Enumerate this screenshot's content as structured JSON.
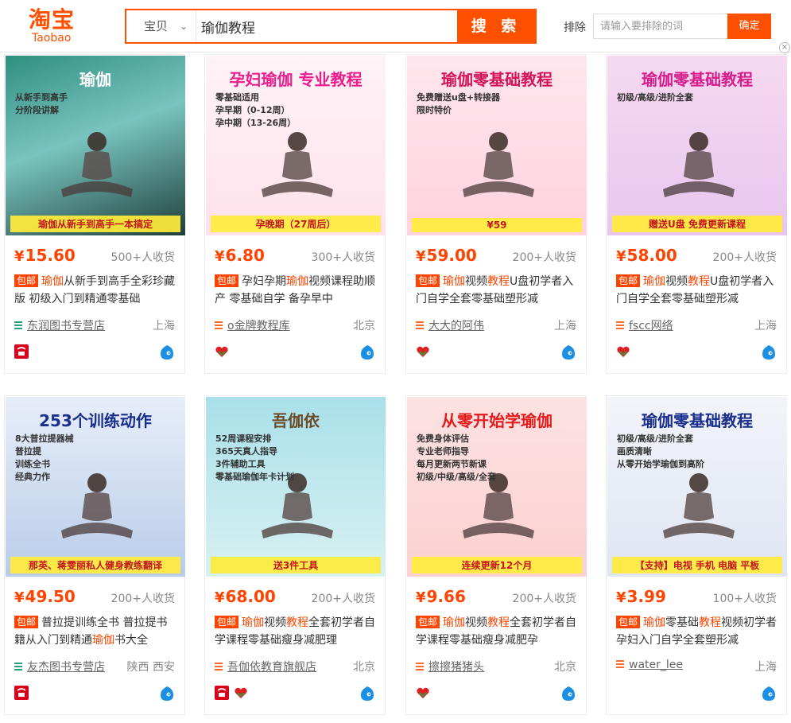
{
  "header": {
    "logo_cn": "淘宝",
    "logo_en": "Taobao",
    "search_category": "宝贝",
    "search_query": "瑜伽教程",
    "search_button": "搜 索",
    "exclude_label": "排除",
    "exclude_placeholder": "请输入要排除的词",
    "exclude_button": "确定"
  },
  "colors": {
    "accent": "#ff5000",
    "price": "#ff4400"
  },
  "items": [
    {
      "price": "15.60",
      "sales": "500+人收货",
      "tag": "包邮",
      "title_pre": "",
      "title_hl": "瑜伽",
      "title_post": "从新手到高手全彩珍藏版 初级入门到精通零基础",
      "shop": "东润图书专营店",
      "location": "上海",
      "img_lines": [
        "瑜伽",
        "从新手到高手",
        "分阶段讲解",
        "瑜伽从新手到高手一本搞定"
      ]
    },
    {
      "price": "6.80",
      "sales": "300+人收货",
      "tag": "包邮",
      "title_pre": "孕妇孕期",
      "title_hl": "瑜伽",
      "title_post": "视频课程助顺产 零基础自学 备孕早中",
      "shop": "o金牌教程库",
      "location": "北京",
      "img_lines": [
        "孕妇瑜伽 专业教程",
        "零基础适用",
        "孕早期（0-12周）",
        "孕中期（13-26周）",
        "孕晚期（27周后）"
      ]
    },
    {
      "price": "59.00",
      "sales": "200+人收货",
      "tag": "包邮",
      "title_pre": "",
      "title_hl": "瑜伽",
      "title_post": "视频",
      "title_hl2": "教程",
      "title_post2": "U盘初学者入门自学全套零基础塑形减",
      "shop": "大大的阿伟",
      "location": "上海",
      "img_lines": [
        "瑜伽零基础教程",
        "免费赠送u盘+转接器",
        "限时特价",
        "¥59"
      ]
    },
    {
      "price": "58.00",
      "sales": "200+人收货",
      "tag": "包邮",
      "title_pre": "",
      "title_hl": "瑜伽",
      "title_post": "视频",
      "title_hl2": "教程",
      "title_post2": "U盘初学者入门自学全套零基础塑形减",
      "shop": "fscc网络",
      "location": "上海",
      "img_lines": [
        "瑜伽零基础教程",
        "初级/高级/进阶全套",
        "赠送U盘 免费更新课程"
      ]
    },
    {
      "price": "49.50",
      "sales": "200+人收货",
      "tag": "包邮",
      "title_pre": "普拉提训练全书 普拉提书籍从入门到精通",
      "title_hl": "瑜伽",
      "title_post": "书大全",
      "shop": "友杰图书专营店",
      "location": "陕西 西安",
      "img_lines": [
        "253个训练动作",
        "8大普拉提器械",
        "普拉提",
        "训练全书",
        "经典力作",
        "那英、蒋雯丽私人健身教练翻译"
      ]
    },
    {
      "price": "68.00",
      "sales": "200+人收货",
      "tag": "包邮",
      "title_pre": "",
      "title_hl": "瑜伽",
      "title_post": "视频",
      "title_hl2": "教程",
      "title_post2": "全套初学者自学课程零基础瘦身减肥理",
      "shop": "吾伽依教育旗舰店",
      "location": "北京",
      "img_lines": [
        "吾伽依",
        "52周课程安排",
        "365天真人指导",
        "3件辅助工具",
        "零基础瑜伽年卡计划",
        "送3件工具"
      ]
    },
    {
      "price": "9.66",
      "sales": "200+人收货",
      "tag": "包邮",
      "title_pre": "",
      "title_hl": "瑜伽",
      "title_post": "视频",
      "title_hl2": "教程",
      "title_post2": "全套初学者自学课程零基础瘦身减肥孕",
      "shop": "擦擦猪猪头",
      "location": "北京",
      "img_lines": [
        "从零开始学瑜伽",
        "免费身体评估",
        "专业老师指导",
        "每月更新两节新课",
        "初级/中级/高级/全套",
        "连续更新12个月"
      ]
    },
    {
      "price": "3.99",
      "sales": "100+人收货",
      "tag": "包邮",
      "title_pre": "",
      "title_hl": "瑜伽",
      "title_post": "零基础",
      "title_hl2": "教程",
      "title_post2": "视频初学者孕妇入门自学全套塑形减",
      "shop": "water_lee",
      "location": "上海",
      "img_lines": [
        "瑜伽零基础教程",
        "初级/高级/进阶全套",
        "画质清晰",
        "从零开始学瑜伽到高阶",
        "【支持】电视 手机 电脑 平板"
      ]
    }
  ]
}
